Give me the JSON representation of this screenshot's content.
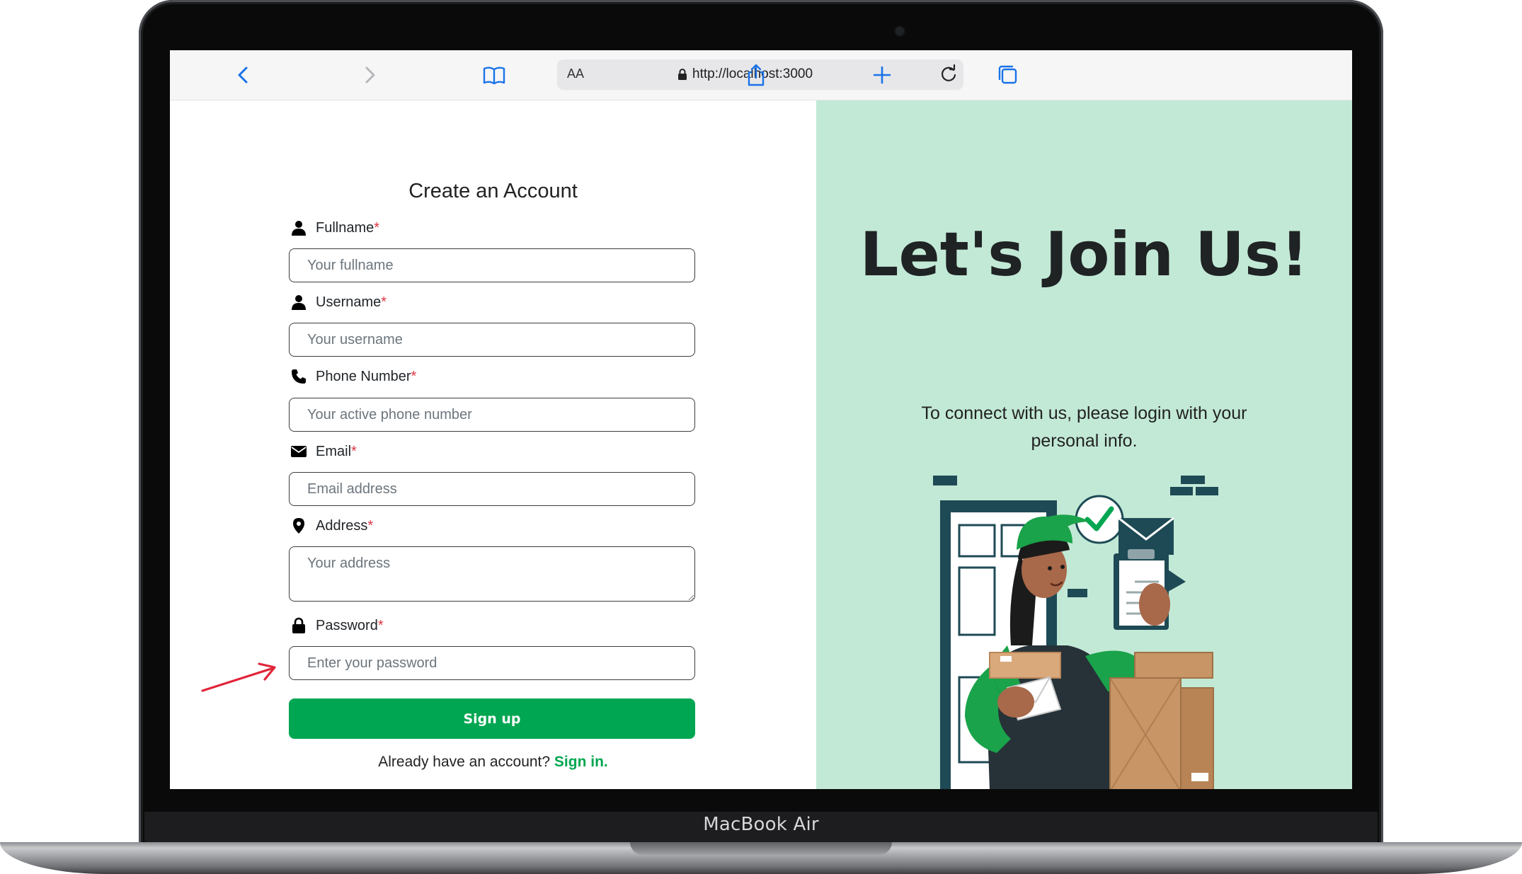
{
  "device": {
    "label": "MacBook Air"
  },
  "browser": {
    "text_size_label": "AA",
    "url": "http://localhost:3000",
    "icons": [
      "back-icon",
      "forward-icon",
      "bookmarks-icon",
      "lock-icon",
      "reload-icon",
      "share-icon",
      "new-tab-icon",
      "tabs-icon"
    ]
  },
  "form": {
    "title": "Create an Account",
    "required_marker": "*",
    "fields": [
      {
        "label": "Fullname",
        "placeholder": "Your fullname",
        "icon": "user-icon"
      },
      {
        "label": "Username",
        "placeholder": "Your username",
        "icon": "user-icon"
      },
      {
        "label": "Phone Number",
        "placeholder": "Your active phone number",
        "icon": "phone-icon"
      },
      {
        "label": "Email",
        "placeholder": "Email address",
        "icon": "envelope-icon"
      },
      {
        "label": "Address",
        "placeholder": "Your address",
        "icon": "map-pin-icon"
      },
      {
        "label": "Password",
        "placeholder": "Enter your password",
        "icon": "lock-icon"
      }
    ],
    "submit_label": "Sign up",
    "signin_prompt": "Already have an account?",
    "signin_link": "Sign in."
  },
  "hero": {
    "title": "Let's Join Us!",
    "subtitle": "To connect with us, please login with your personal info."
  },
  "colors": {
    "accent": "#00a651",
    "hero_background": "#c2e9d6",
    "required": "#dc3545",
    "annotation_arrow": "#e0263a"
  }
}
